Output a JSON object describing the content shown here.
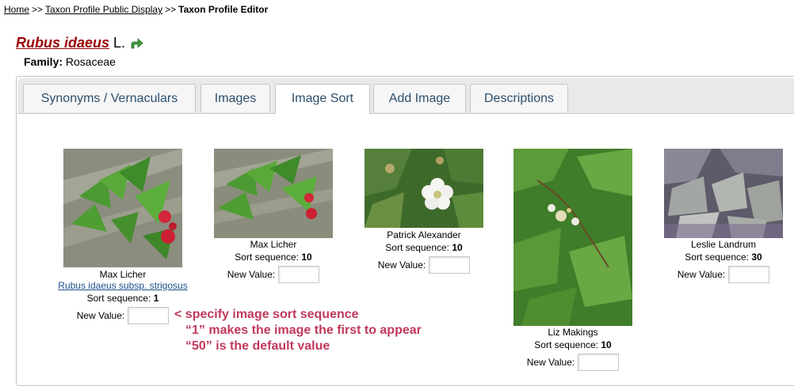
{
  "breadcrumb": {
    "home": "Home",
    "sep1": ">>",
    "public_display": "Taxon Profile Public Display",
    "sep2": ">>",
    "current": "Taxon Profile Editor"
  },
  "taxon": {
    "scientific_name": "Rubus idaeus",
    "author": "L.",
    "family_label": "Family:",
    "family_value": "Rosaceae",
    "up_icon": "green-up-arrow-icon"
  },
  "tabs": [
    {
      "label": "Synonyms / Vernaculars",
      "active": false
    },
    {
      "label": "Images",
      "active": false
    },
    {
      "label": "Image Sort",
      "active": true
    },
    {
      "label": "Add Image",
      "active": false
    },
    {
      "label": "Descriptions",
      "active": false
    }
  ],
  "images": [
    {
      "photographer": "Max Licher",
      "caption": "Rubus idaeus subsp. strigosus",
      "sort_label": "Sort sequence:",
      "sort_value": "1",
      "new_value_label": "New Value:",
      "new_value": ""
    },
    {
      "photographer": "Max Licher",
      "sort_label": "Sort sequence:",
      "sort_value": "10",
      "new_value_label": "New Value:",
      "new_value": ""
    },
    {
      "photographer": "Patrick Alexander",
      "sort_label": "Sort sequence:",
      "sort_value": "10",
      "new_value_label": "New Value:",
      "new_value": ""
    },
    {
      "photographer": "Liz Makings",
      "sort_label": "Sort sequence:",
      "sort_value": "10",
      "new_value_label": "New Value:",
      "new_value": ""
    },
    {
      "photographer": "Leslie Landrum",
      "sort_label": "Sort sequence:",
      "sort_value": "30",
      "new_value_label": "New Value:",
      "new_value": ""
    }
  ],
  "annotation": {
    "line1": "< specify image sort sequence",
    "line2": "“1” makes the image the first to appear",
    "line3": "“50” is the default value",
    "color": "#c0395a"
  },
  "colors": {
    "taxon_name": "#990000",
    "tab_text": "#2b4f6e",
    "link": "#1a4f8a"
  }
}
